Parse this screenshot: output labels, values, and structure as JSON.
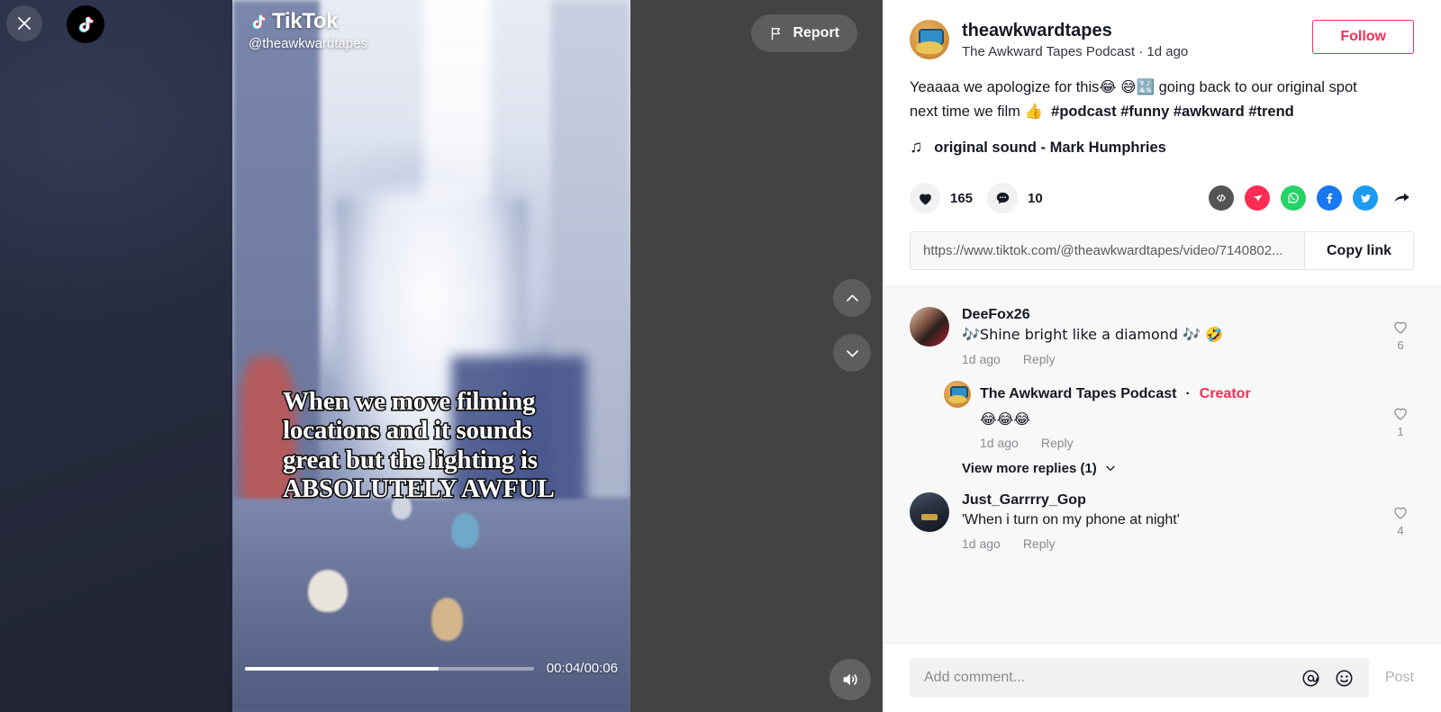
{
  "video_stage": {
    "close_icon": "close-icon",
    "logo_icon": "tiktok-logo-icon",
    "wordmark": "TikTok",
    "handle": "@theawkwardtapes",
    "report_label": "Report",
    "report_icon": "flag-icon",
    "nav_up_icon": "chevron-up-icon",
    "nav_down_icon": "chevron-down-icon",
    "mute_icon": "volume-on-icon",
    "time_label": "00:04/00:06",
    "progress_percent": 67,
    "caption_lines": [
      "When we move filming",
      "locations and it sounds",
      "great but the lighting is",
      "ABSOLUTELY AWFUL"
    ]
  },
  "author": {
    "handle": "theawkwardtapes",
    "display_name_and_time": "The Awkward Tapes Podcast · 1d ago",
    "follow_label": "Follow",
    "follow_color": "#fe2c55",
    "avatar_icon": "cassette-tape-avatar"
  },
  "post": {
    "description_part1": "Yeaaaa we apologize for this",
    "emoji1": "😂",
    "emoji2": "😅",
    "emoji3": "🔣",
    "description_part2": " going back to our original spot next time we film ",
    "emoji4": "👍",
    "hashtags": "#podcast #funny #awkward #trend",
    "music_note_icon": "music-note-icon",
    "music_label": "original sound - Mark Humphries"
  },
  "stats": {
    "like_icon": "heart-filled-icon",
    "like_count": "165",
    "comment_icon": "comment-bubble-icon",
    "comment_count": "10",
    "share_targets": [
      {
        "name": "embed-icon",
        "color": "#545454",
        "glyph": "</>"
      },
      {
        "name": "send-message-icon",
        "color": "#fe2c55",
        "glyph": "send"
      },
      {
        "name": "whatsapp-icon",
        "color": "#25d366",
        "glyph": "whatsapp"
      },
      {
        "name": "facebook-icon",
        "color": "#1877f2",
        "glyph": "f"
      },
      {
        "name": "twitter-icon",
        "color": "#1d9bf0",
        "glyph": "twitter"
      },
      {
        "name": "share-arrow-icon",
        "color": "#161823",
        "glyph": "arrow"
      }
    ]
  },
  "share_link": {
    "url": "https://www.tiktok.com/@theawkwardtapes/video/7140802...",
    "copy_label": "Copy link"
  },
  "comments": [
    {
      "avatar_icon": "deefox-avatar",
      "user": "DeeFox26",
      "text": "🎶Shine bright like a diamond 🎶 🤣",
      "time": "1d ago",
      "reply_label": "Reply",
      "like_count": "6",
      "like_icon": "heart-outline-icon"
    },
    {
      "avatar_icon": "cassette-tape-avatar",
      "user": "The Awkward Tapes Podcast",
      "creator_separator": "·",
      "creator_label": "Creator",
      "text": "😂😂😂",
      "time": "1d ago",
      "reply_label": "Reply",
      "like_count": "1",
      "like_icon": "heart-outline-icon"
    },
    {
      "avatar_icon": "batman-avatar",
      "user": "Just_Garrrry_Gop",
      "text": "'When i turn on my phone at night'",
      "time": "1d ago",
      "reply_label": "Reply",
      "like_count": "4",
      "like_icon": "heart-outline-icon"
    }
  ],
  "view_more_replies": {
    "label": "View more replies (1)",
    "chevron_icon": "chevron-down-icon"
  },
  "comment_box": {
    "placeholder": "Add comment...",
    "mention_icon": "at-mention-icon",
    "emoji_icon": "emoji-smile-icon",
    "post_label": "Post"
  }
}
